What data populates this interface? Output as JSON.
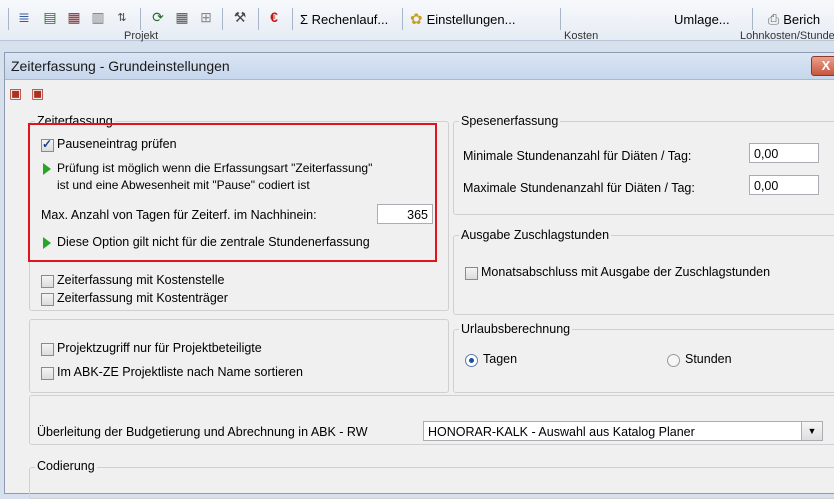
{
  "toolbar": {
    "rechenlauf_label": "Σ Rechenlauf...",
    "einstellungen_label": "Einstellungen...",
    "umlage_label": "Umlage...",
    "bericht_label": "Berich",
    "euro_symbol": "€"
  },
  "column_headers": {
    "projekt": "Projekt",
    "kosten": "Kosten",
    "lohnkosten": "Lohnkosten/Stunde"
  },
  "dialog": {
    "title": "Zeiterfassung - Grundeinstellungen",
    "close_label": "X"
  },
  "zeiterfassung": {
    "group_title": "Zeiterfassung",
    "pause_label": "Pauseneintrag prüfen",
    "pause_checked": true,
    "pause_info_line1": "Prüfung ist möglich wenn die Erfassungsart \"Zeiterfassung\"",
    "pause_info_line2": "ist und eine Abwesenheit mit \"Pause\" codiert ist",
    "max_days_label": "Max. Anzahl von Tagen für Zeiterf. im Nachhinein:",
    "max_days_value": "365",
    "option_info": "Diese Option gilt nicht für die zentrale Stundenerfassung",
    "kostenstelle_label": "Zeiterfassung mit Kostenstelle",
    "kostentraeger_label": "Zeiterfassung mit Kostenträger"
  },
  "projekt": {
    "zugriff_label": "Projektzugriff nur für Projektbeteiligte",
    "sortieren_label": "Im ABK-ZE Projektliste nach Name sortieren"
  },
  "spesen": {
    "group_title": "Spesenerfassung",
    "min_label": "Minimale Stundenanzahl für Diäten / Tag:",
    "min_value": "0,00",
    "max_label": "Maximale Stundenanzahl für Diäten / Tag:",
    "max_value": "0,00"
  },
  "zuschlag": {
    "group_title": "Ausgabe Zuschlagstunden",
    "monat_label": "Monatsabschluss mit Ausgabe der Zuschlagstunden"
  },
  "urlaub": {
    "group_title": "Urlaubsberechnung",
    "tagen_label": "Tagen",
    "stunden_label": "Stunden",
    "selected": "Tagen"
  },
  "ueberleitung": {
    "label": "Überleitung der Budgetierung und Abrechnung in ABK - RW",
    "selected_value": "HONORAR-KALK - Auswahl aus Katalog Planer"
  },
  "codierung": {
    "group_title": "Codierung"
  },
  "colors": {
    "highlight": "#e0141e",
    "arrow": "#28a428"
  }
}
